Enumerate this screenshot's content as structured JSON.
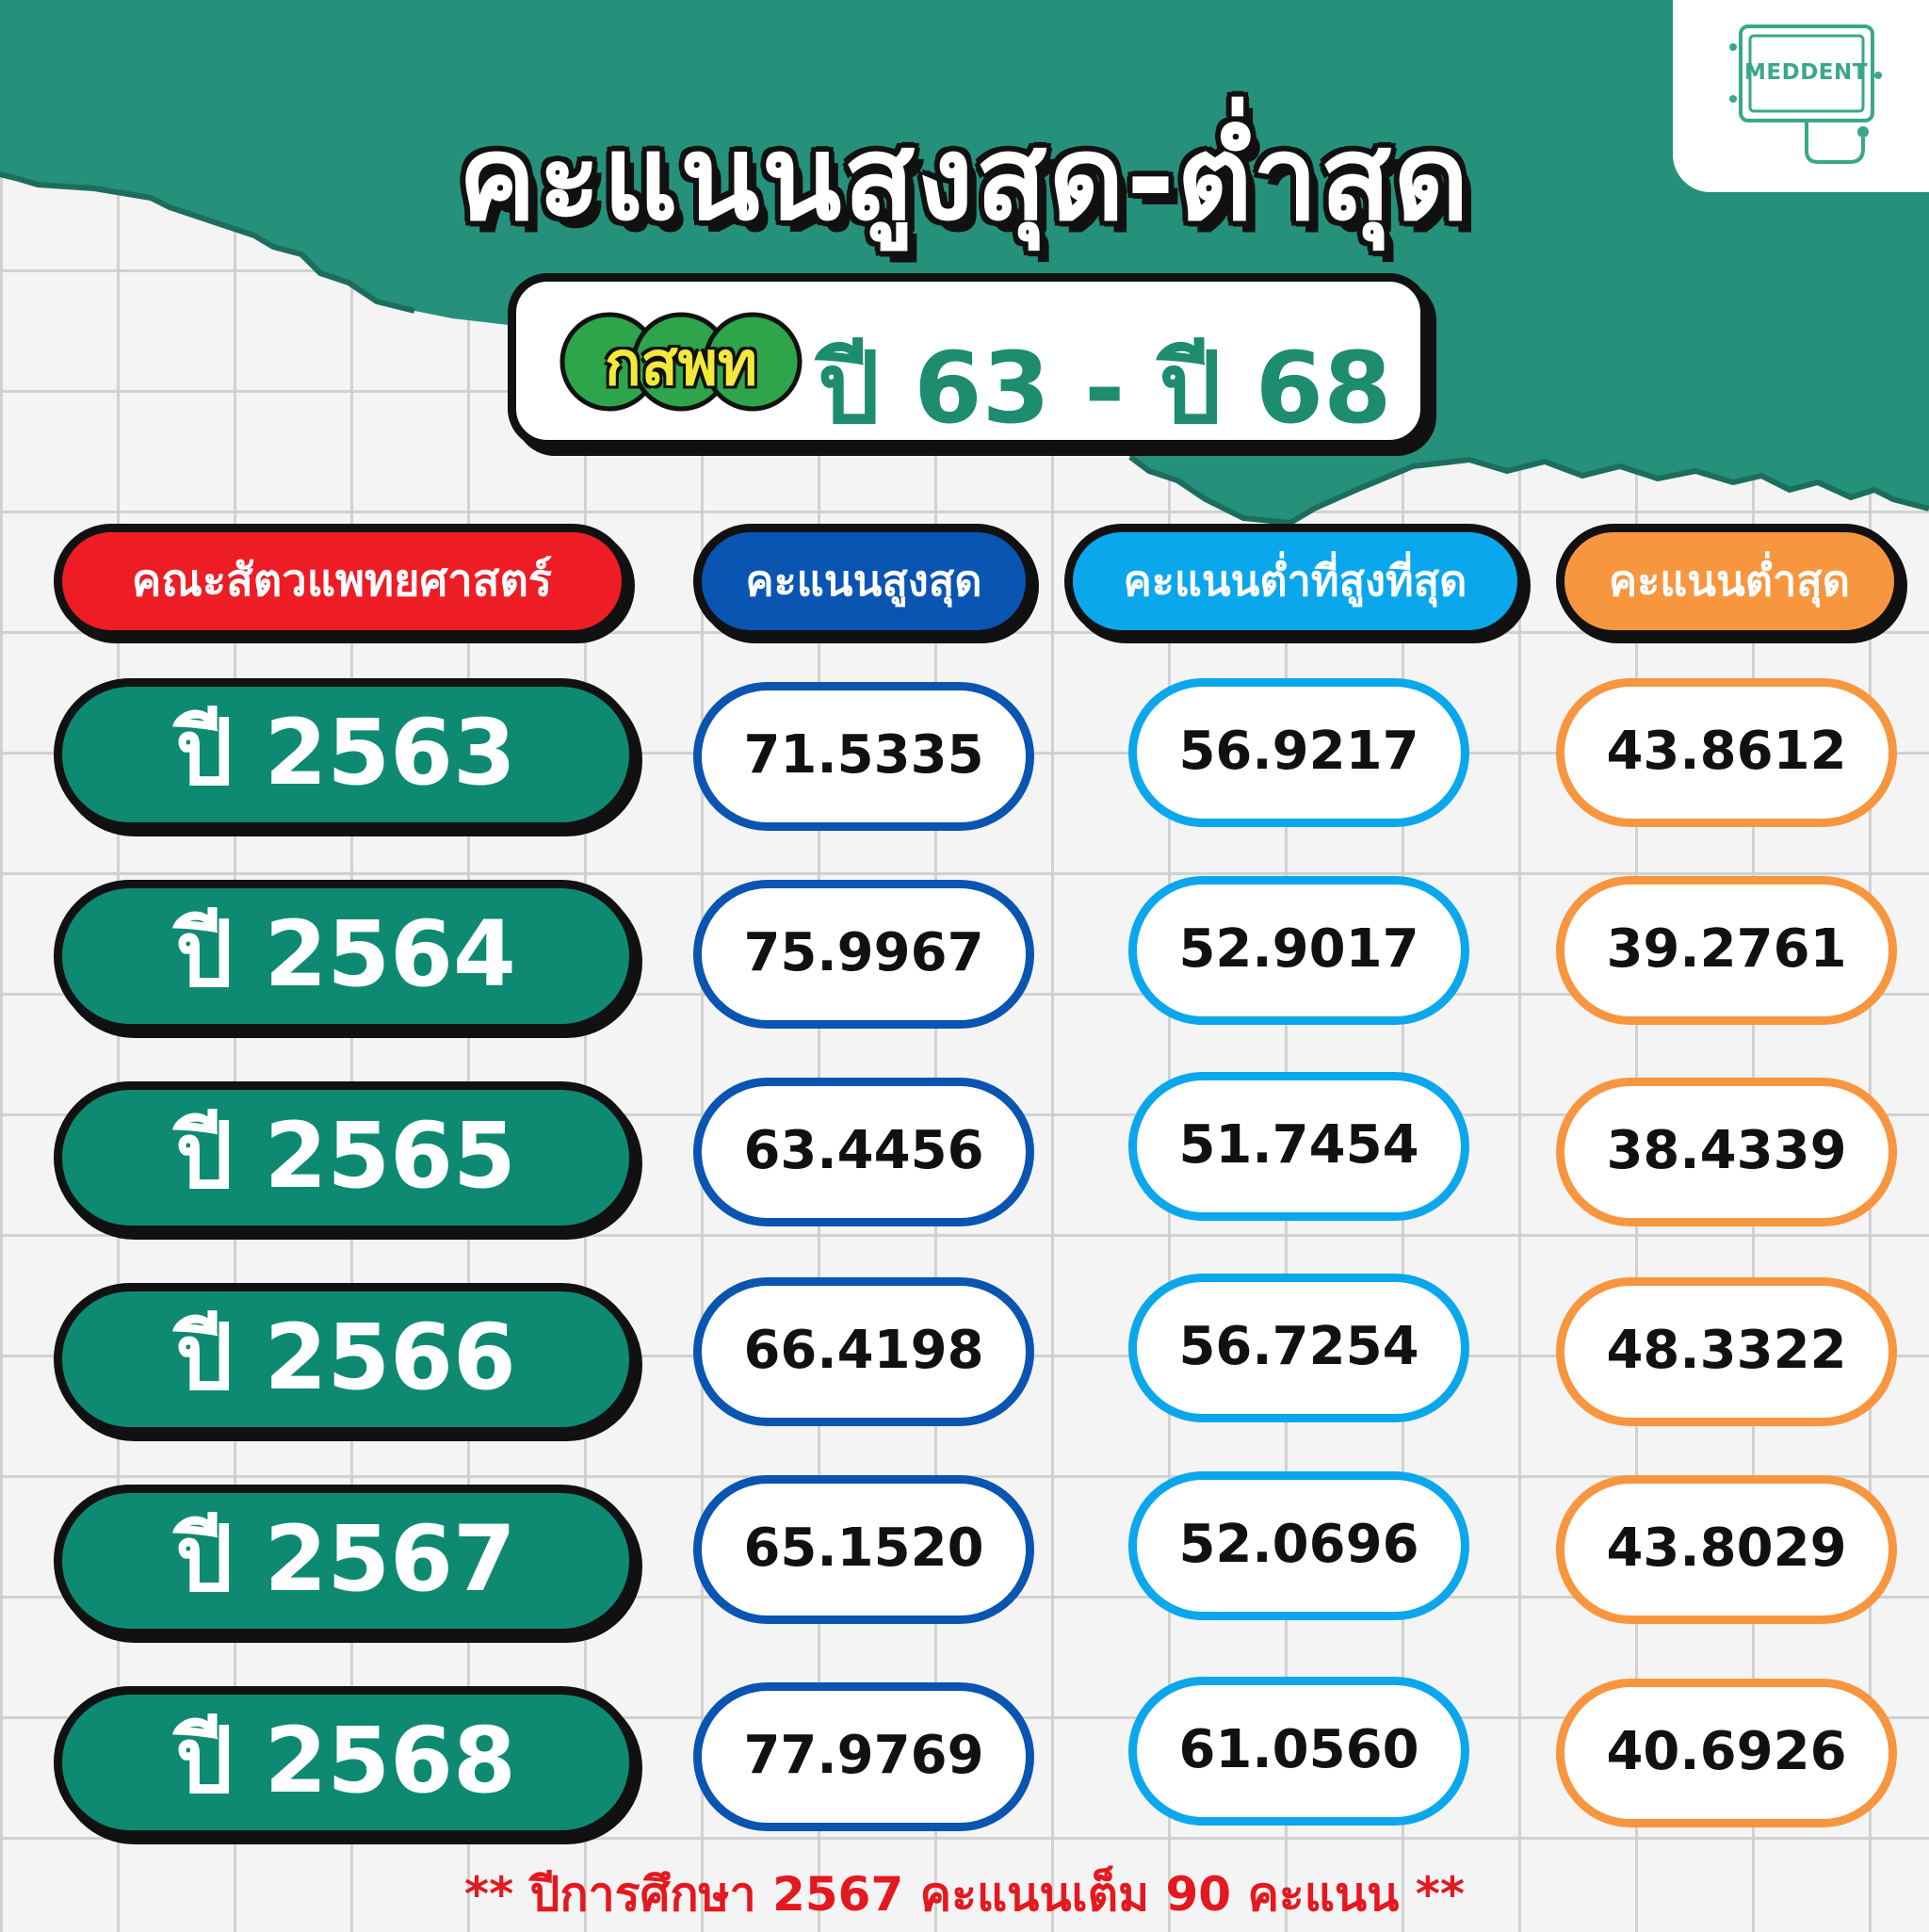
{
  "title": "คะแนนสูงสุด-ต่ำสุด",
  "logo": {
    "text": "MEDDENT"
  },
  "subtitle": {
    "emblem_text": "กสพท",
    "year_range": "ปี 63 - ปี 68"
  },
  "headers": {
    "faculty": "คณะสัตวแพทยศาสตร์",
    "max": "คะแนนสูงสุด",
    "mid": "คะแนนต่ำที่สูงที่สุด",
    "min": "คะแนนต่ำสุด"
  },
  "rows": [
    {
      "year": "ปี 2563",
      "max": "71.5335",
      "mid": "56.9217",
      "min": "43.8612"
    },
    {
      "year": "ปี 2564",
      "max": "75.9967",
      "mid": "52.9017",
      "min": "39.2761"
    },
    {
      "year": "ปี 2565",
      "max": "63.4456",
      "mid": "51.7454",
      "min": "38.4339"
    },
    {
      "year": "ปี 2566",
      "max": "66.4198",
      "mid": "56.7254",
      "min": "48.3322"
    },
    {
      "year": "ปี 2567",
      "max": "65.1520",
      "mid": "52.0696",
      "min": "43.8029"
    },
    {
      "year": "ปี 2568",
      "max": "77.9769",
      "mid": "61.0560",
      "min": "40.6926"
    }
  ],
  "footnote": "** ปีการศึกษา 2567 คะแนนเต็ม 90 คะแนน **",
  "colors": {
    "teal": "#26917a",
    "faculty_header": "#ee1c25",
    "max_color": "#0a54b2",
    "mid_color": "#0ba7ec",
    "min_color": "#f7963f",
    "year_pill": "#0e8a72",
    "footnote": "#e4181f"
  }
}
